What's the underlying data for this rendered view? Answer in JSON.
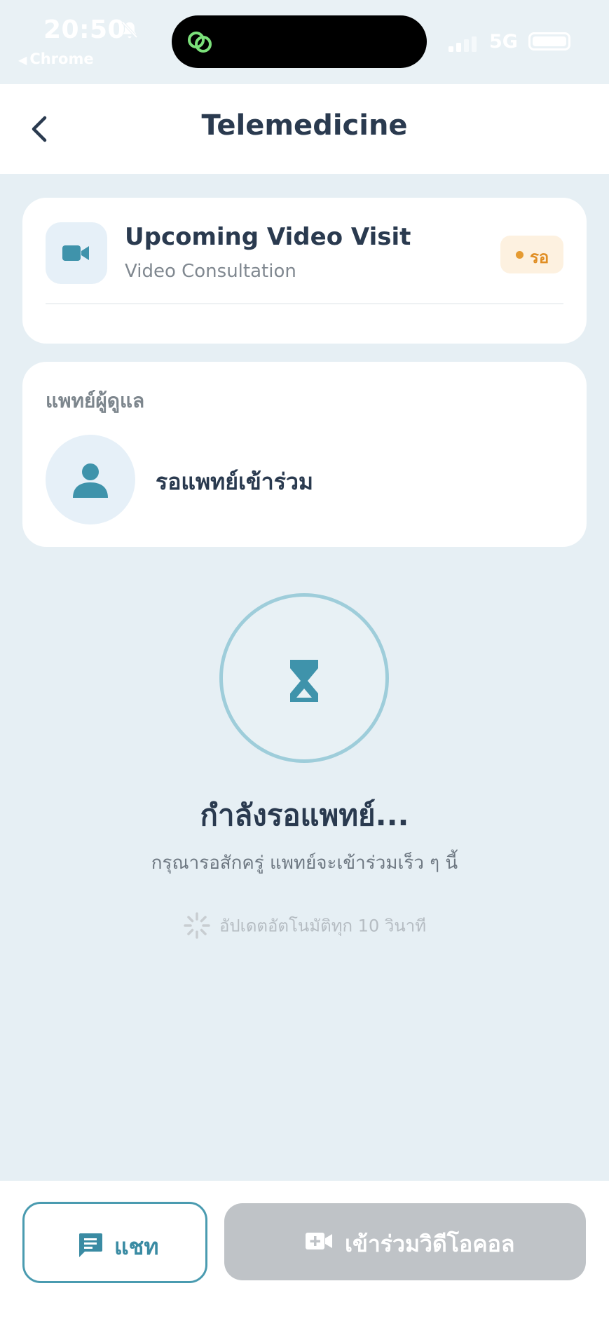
{
  "status_bar": {
    "time": "20:50",
    "back_app": "Chrome",
    "network": "5G"
  },
  "header": {
    "title": "Telemedicine"
  },
  "visit_card": {
    "title": "Upcoming Video Visit",
    "subtitle": "Video Consultation",
    "status": "รอ",
    "status_color": "#e08e24"
  },
  "doctor_card": {
    "label": "แพทย์ผู้ดูแล",
    "name": "รอแพทย์เข้าร่วม"
  },
  "waiting": {
    "title": "กำลังรอแพทย์...",
    "subtitle": "กรุณารอสักครู่ แพทย์จะเข้าร่วมเร็ว ๆ นี้",
    "update_text": "อัปเดตอัตโนมัติทุก 10 วินาที"
  },
  "actions": {
    "chat_label": "แชท",
    "join_label": "เข้าร่วมวิดีโอคอล"
  },
  "colors": {
    "accent": "#4a9bb0",
    "background": "#e6eff4",
    "disabled": "#bfc3c7"
  }
}
